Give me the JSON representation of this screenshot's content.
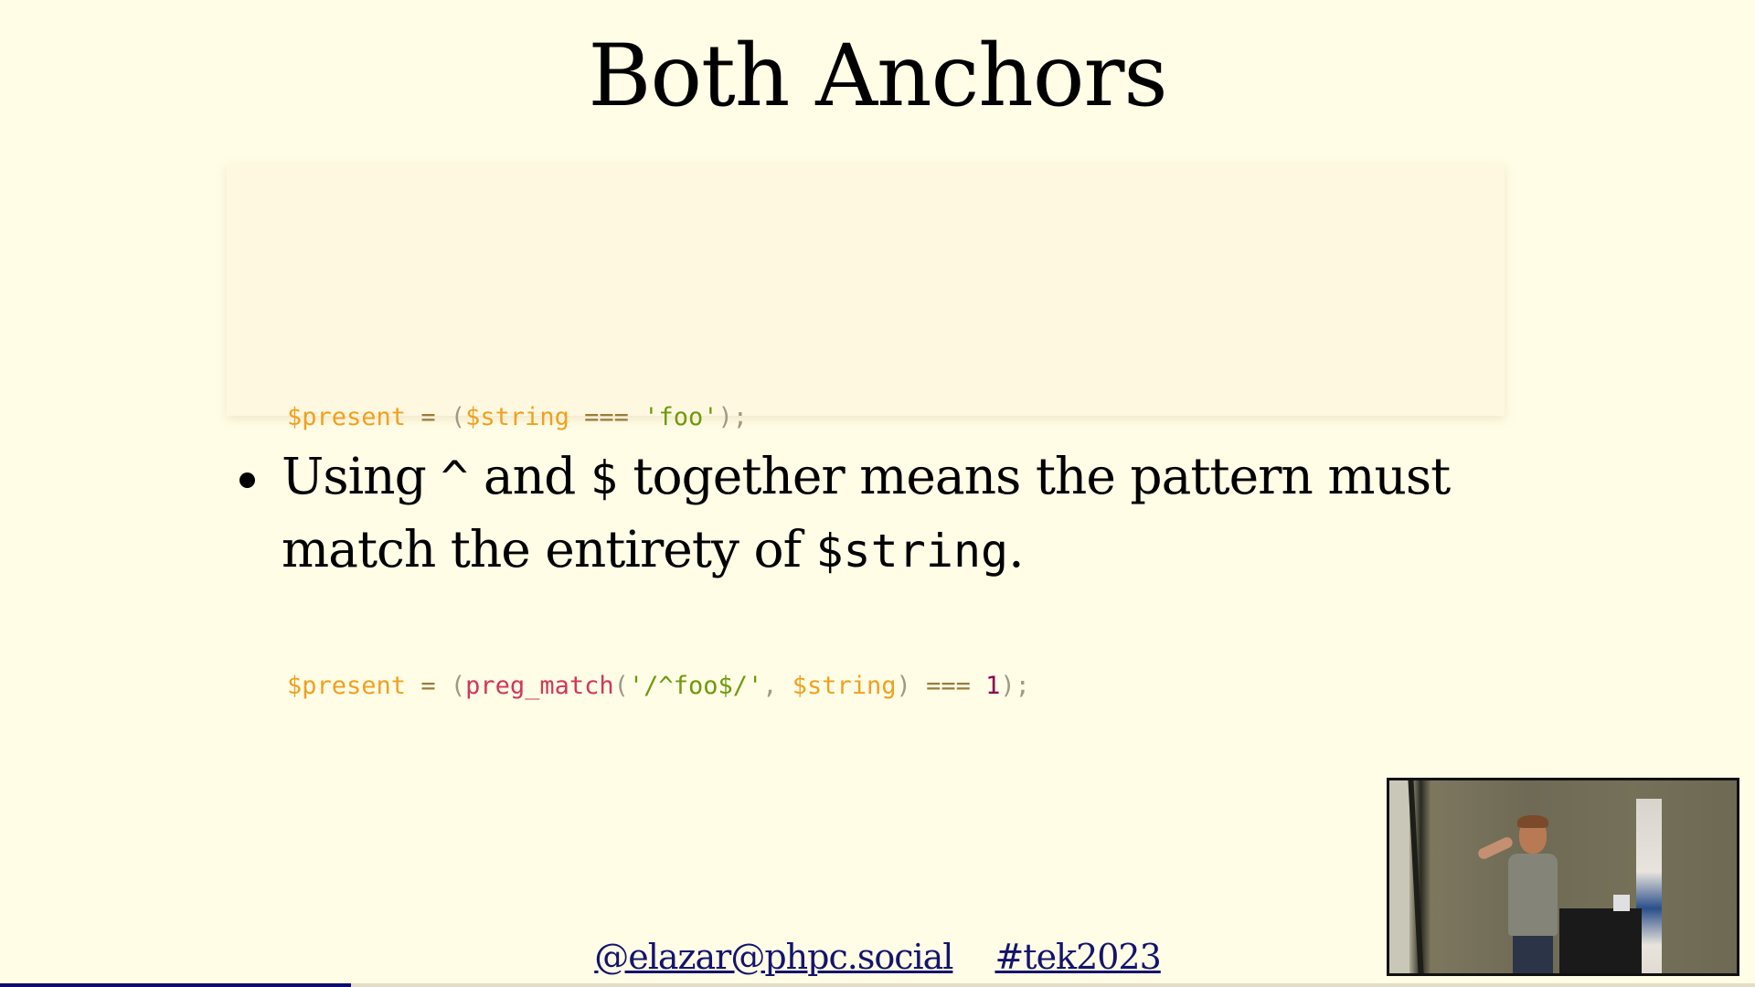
{
  "slide": {
    "title": "Both Anchors",
    "code": {
      "lines": [
        {
          "tokens": [
            {
              "type": "var",
              "text": "$present"
            },
            {
              "type": "punc",
              "text": " "
            },
            {
              "type": "op",
              "text": "="
            },
            {
              "type": "punc",
              "text": " ("
            },
            {
              "type": "var",
              "text": "$string"
            },
            {
              "type": "punc",
              "text": " "
            },
            {
              "type": "op",
              "text": "==="
            },
            {
              "type": "punc",
              "text": " "
            },
            {
              "type": "str",
              "text": "'foo'"
            },
            {
              "type": "punc",
              "text": ");"
            }
          ]
        },
        {
          "tokens": [
            {
              "type": "var",
              "text": "$present"
            },
            {
              "type": "punc",
              "text": " "
            },
            {
              "type": "op",
              "text": "="
            },
            {
              "type": "punc",
              "text": " ("
            },
            {
              "type": "fn",
              "text": "preg_match"
            },
            {
              "type": "punc",
              "text": "("
            },
            {
              "type": "str",
              "text": "'/^foo$/'"
            },
            {
              "type": "punc",
              "text": ", "
            },
            {
              "type": "var",
              "text": "$string"
            },
            {
              "type": "punc",
              "text": ") "
            },
            {
              "type": "op",
              "text": "==="
            },
            {
              "type": "punc",
              "text": " "
            },
            {
              "type": "num",
              "text": "1"
            },
            {
              "type": "punc",
              "text": ");"
            }
          ]
        }
      ]
    },
    "bullets": [
      {
        "parts": [
          {
            "kind": "text",
            "text": "Using "
          },
          {
            "kind": "code",
            "text": "^"
          },
          {
            "kind": "text",
            "text": " and "
          },
          {
            "kind": "code",
            "text": "$"
          },
          {
            "kind": "text",
            "text": " together means the pattern must match the entirety of "
          },
          {
            "kind": "code",
            "text": "$string"
          },
          {
            "kind": "text",
            "text": "."
          }
        ]
      }
    ],
    "footer": {
      "handle": "@elazar@phpc.social",
      "hashtag": "#tek2023"
    },
    "progress": {
      "fraction": 0.2
    },
    "webcam": {
      "label": "speaker-video"
    }
  },
  "colors": {
    "background": "#fffde6",
    "code_background": "#fff8e1",
    "link": "#14146e",
    "progress": "#0e0a6e",
    "progress_track": "#e3dcc6",
    "code_var": "#f0a020",
    "code_operator": "#9b7a3c",
    "code_punctuation": "#a09888",
    "code_string": "#6e9a0c",
    "code_function": "#d0375a",
    "code_number": "#8a0050"
  }
}
